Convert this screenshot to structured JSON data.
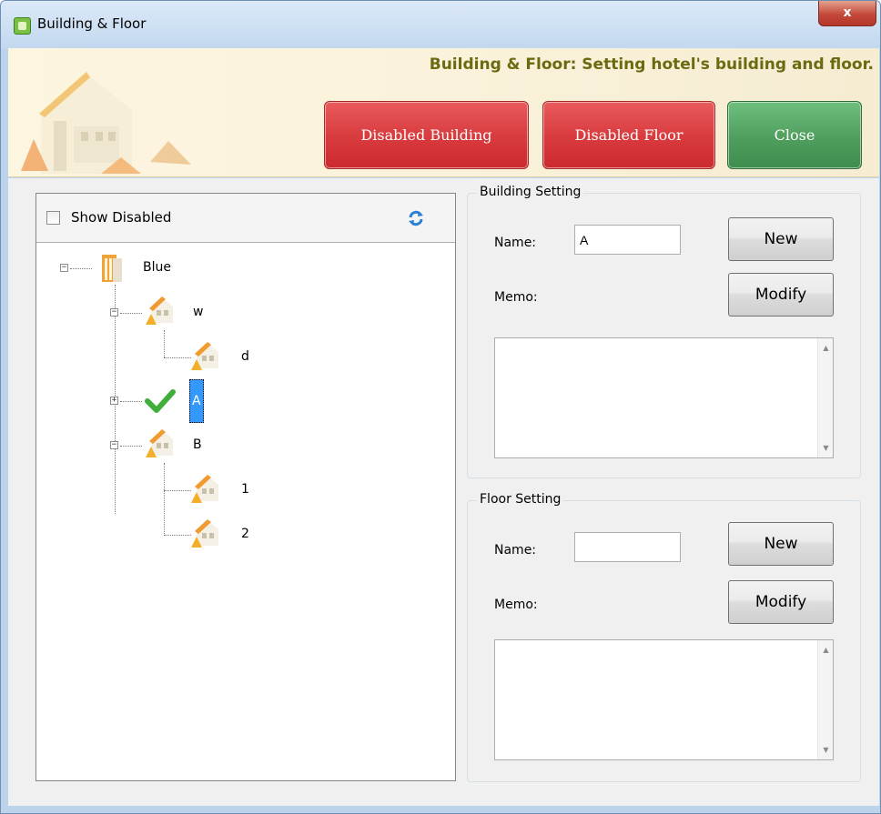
{
  "window": {
    "title": "Building & Floor",
    "close_glyph": "x"
  },
  "header": {
    "subtitle": "Building & Floor: Setting hotel's building and floor.",
    "buttons": {
      "disabled_building": "Disabled Building",
      "disabled_floor": "Disabled Floor",
      "close": "Close"
    }
  },
  "tree": {
    "show_disabled_label": "Show Disabled",
    "show_disabled_checked": false,
    "nodes": {
      "root": "Blue",
      "w": "w",
      "d": "d",
      "a": "A",
      "b": "B",
      "n1": "1",
      "n2": "2"
    },
    "selected": "A"
  },
  "building_setting": {
    "title": "Building Setting",
    "name_label": "Name:",
    "name_value": "A",
    "memo_label": "Memo:",
    "memo_value": "",
    "new_label": "New",
    "modify_label": "Modify"
  },
  "floor_setting": {
    "title": "Floor Setting",
    "name_label": "Name:",
    "name_value": "",
    "memo_label": "Memo:",
    "memo_value": "",
    "new_label": "New",
    "modify_label": "Modify"
  },
  "scroll_glyphs": {
    "up": "▲",
    "down": "▼"
  },
  "colors": {
    "header_text": "#6b6a10",
    "btn_red": "#d83a3d",
    "btn_green": "#4f9e5e",
    "selection": "#3399ff"
  },
  "icons": [
    "app-icon",
    "window-close-icon",
    "hotel-illustration-icon",
    "refresh-icon",
    "building-icon",
    "floor-icon",
    "check-icon",
    "expand-icon",
    "collapse-icon"
  ]
}
